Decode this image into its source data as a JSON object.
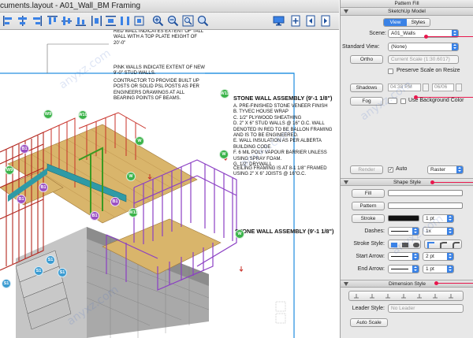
{
  "window": {
    "title": "cuments.layout - A01_Wall_BM Framing"
  },
  "drawing": {
    "notes": {
      "red_wall": "RED WALL INDICATES EXTENT OF TALL\nWALL WITH A TOP PLATE HEIGHT OF\n20'-0\"",
      "pink_walls": "PINK WALLS INDICATE EXTENT OF NEW\n9'-0\" STUD WALLS.",
      "contractor": "CONTRACTOR TO PROVIDE BUILT UP\nPOSTS OR SOLID PSL POSTS AS PER\nENGINEERS DRAWINGS AT ALL\nBEARING POINTS OF BEAMS.",
      "stone_wall_1_title": "STONE WALL ASSEMBLY (9'-1 1/8\")",
      "stone_wall_1_body": "A. PRE-FINISHED STONE VENEER FINISH\nB. TYVEC HOUSE WRAP\nC. 1/2\" PLYWOOD SHEATHING\nD. 2\" X 6\" STUD WALLS @ 16\" O.C. WALL\nDENOTED IN RED TO BE BALLON FRAMING\nAND IS TO BE ENGINEERED.\nE. WALL INSULATION AS PER ALBERTA\nBUILDING CODE\nF. 6 MIL POLY VAPOUR BARRIER UNLESS\nUSING SPRAY FOAM.\nG. 1/2\" DRYWALL",
      "ceiling": "CEILING FRAMING IS AT 8-1 1/8\" FRAMED\nUSING 2\" X 6\" JOISTS @ 16\"O.C.",
      "stone_wall_2_title": "STONE WALL ASSEMBLY (9'-1 1/8\")"
    },
    "tags": [
      {
        "label": "W11",
        "color": "#3bb34a"
      },
      {
        "label": "W",
        "color": "#3bb34a"
      },
      {
        "label": "W9",
        "color": "#3bb34a"
      },
      {
        "label": "W10",
        "color": "#3bb34a"
      },
      {
        "label": "W",
        "color": "#3bb34a"
      },
      {
        "label": "W",
        "color": "#3bb34a"
      },
      {
        "label": "W11",
        "color": "#3bb34a"
      },
      {
        "label": "W",
        "color": "#3bb34a"
      },
      {
        "label": "W9",
        "color": "#3bb34a"
      },
      {
        "label": "B1",
        "color": "#9a4fc2"
      },
      {
        "label": "B1",
        "color": "#9a4fc2"
      },
      {
        "label": "B1",
        "color": "#9a4fc2"
      },
      {
        "label": "B1",
        "color": "#9a4fc2"
      },
      {
        "label": "B1",
        "color": "#9a4fc2"
      },
      {
        "label": "S1",
        "color": "#3b9bd1"
      },
      {
        "label": "S1",
        "color": "#3b9bd1"
      },
      {
        "label": "S1",
        "color": "#3b9bd1"
      },
      {
        "label": "S1",
        "color": "#3b9bd1"
      }
    ]
  },
  "panel": {
    "title": "Pattern Fill",
    "sketchup": {
      "title": "SketchUp Model",
      "tabs": [
        "View",
        "Styles"
      ],
      "scene_label": "Scene:",
      "scene_value": "A01_Walls",
      "standard_view_label": "Standard View:",
      "standard_view_value": "(None)",
      "ortho_label": "Ortho",
      "current_scale": "Current Scale (1:30.6017)",
      "preserve_scale": "Preserve Scale on Resize",
      "shadows_label": "Shadows",
      "shadow_time": "04:38 PM",
      "shadow_date": "06/06",
      "fog_label": "Fog",
      "use_bg_color": "Use Background Color",
      "render_label": "Render",
      "auto_label": "Auto",
      "auto_checked": "✓",
      "render_mode": "Raster"
    },
    "shape_style": {
      "title": "Shape Style",
      "fill_label": "Fill",
      "pattern_label": "Pattern",
      "stroke_label": "Stroke",
      "stroke_width": "1 pt",
      "dashes_label": "Dashes:",
      "dashes_value": "1x",
      "stroke_style_label": "Stroke Style:",
      "start_arrow_label": "Start Arrow:",
      "start_arrow_size": "2 pt",
      "end_arrow_label": "End Arrow:",
      "end_arrow_size": "1 pt"
    },
    "dimension_style": {
      "title": "Dimension Style",
      "leader_style_label": "Leader Style:",
      "leader_style_value": "No Leader",
      "auto_scale_label": "Auto Scale"
    }
  },
  "watermark": "anyxz.com",
  "colors": {
    "accent_blue": "#3a82e6",
    "callout_red": "#e8174d",
    "framing_red": "#c8322a",
    "framing_purple": "#8b3fc4",
    "framing_green": "#4caf2d",
    "framing_teal": "#2f9aa6",
    "floor_wood": "#d9b56b"
  }
}
